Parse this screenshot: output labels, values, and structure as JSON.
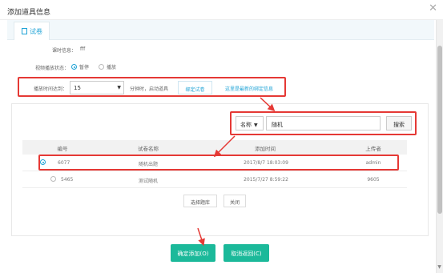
{
  "modal": {
    "title": "添加道具信息",
    "close_glyph": "✕"
  },
  "tabs": [
    {
      "label": "试卷"
    }
  ],
  "form": {
    "lesson_info_label": "课时信息：",
    "lesson_info_value": "fff",
    "video_state_label": "视频播放状态：",
    "video_state_options": [
      "暂停",
      "播放"
    ],
    "video_state_selected": "暂停",
    "play_time_label": "播放时间达到：",
    "play_time_value": "15",
    "play_time_suffix": "分钟时，启动道具",
    "bind_paper_button": "绑定试卷",
    "latest_bind_link": "这里是最新的绑定信息"
  },
  "search": {
    "field_select": "名称",
    "query_value": "随机",
    "search_button": "搜索"
  },
  "table": {
    "headers": [
      "编号",
      "试卷名称",
      "添加时间",
      "上传者"
    ],
    "rows": [
      {
        "id": "6077",
        "name": "随机出题",
        "time": "2017/8/7 18:03:09",
        "uploader": "admin",
        "selected": true
      },
      {
        "id": "5465",
        "name": "测试随机",
        "time": "2015/7/27 8:59:22",
        "uploader": "9605",
        "selected": false
      }
    ]
  },
  "panel_buttons": {
    "choose_bank": "选择题库",
    "close": "关闭"
  },
  "footer": {
    "confirm_button": "确定添加(O)",
    "cancel_button": "取消返回(C)"
  },
  "colors": {
    "accent": "#1fa3d6",
    "primary": "#1bb99a",
    "annotation": "#e53935"
  },
  "icons": {
    "tab_icon": "document-icon",
    "close": "close-icon",
    "dropdown": "caret-down-icon"
  }
}
